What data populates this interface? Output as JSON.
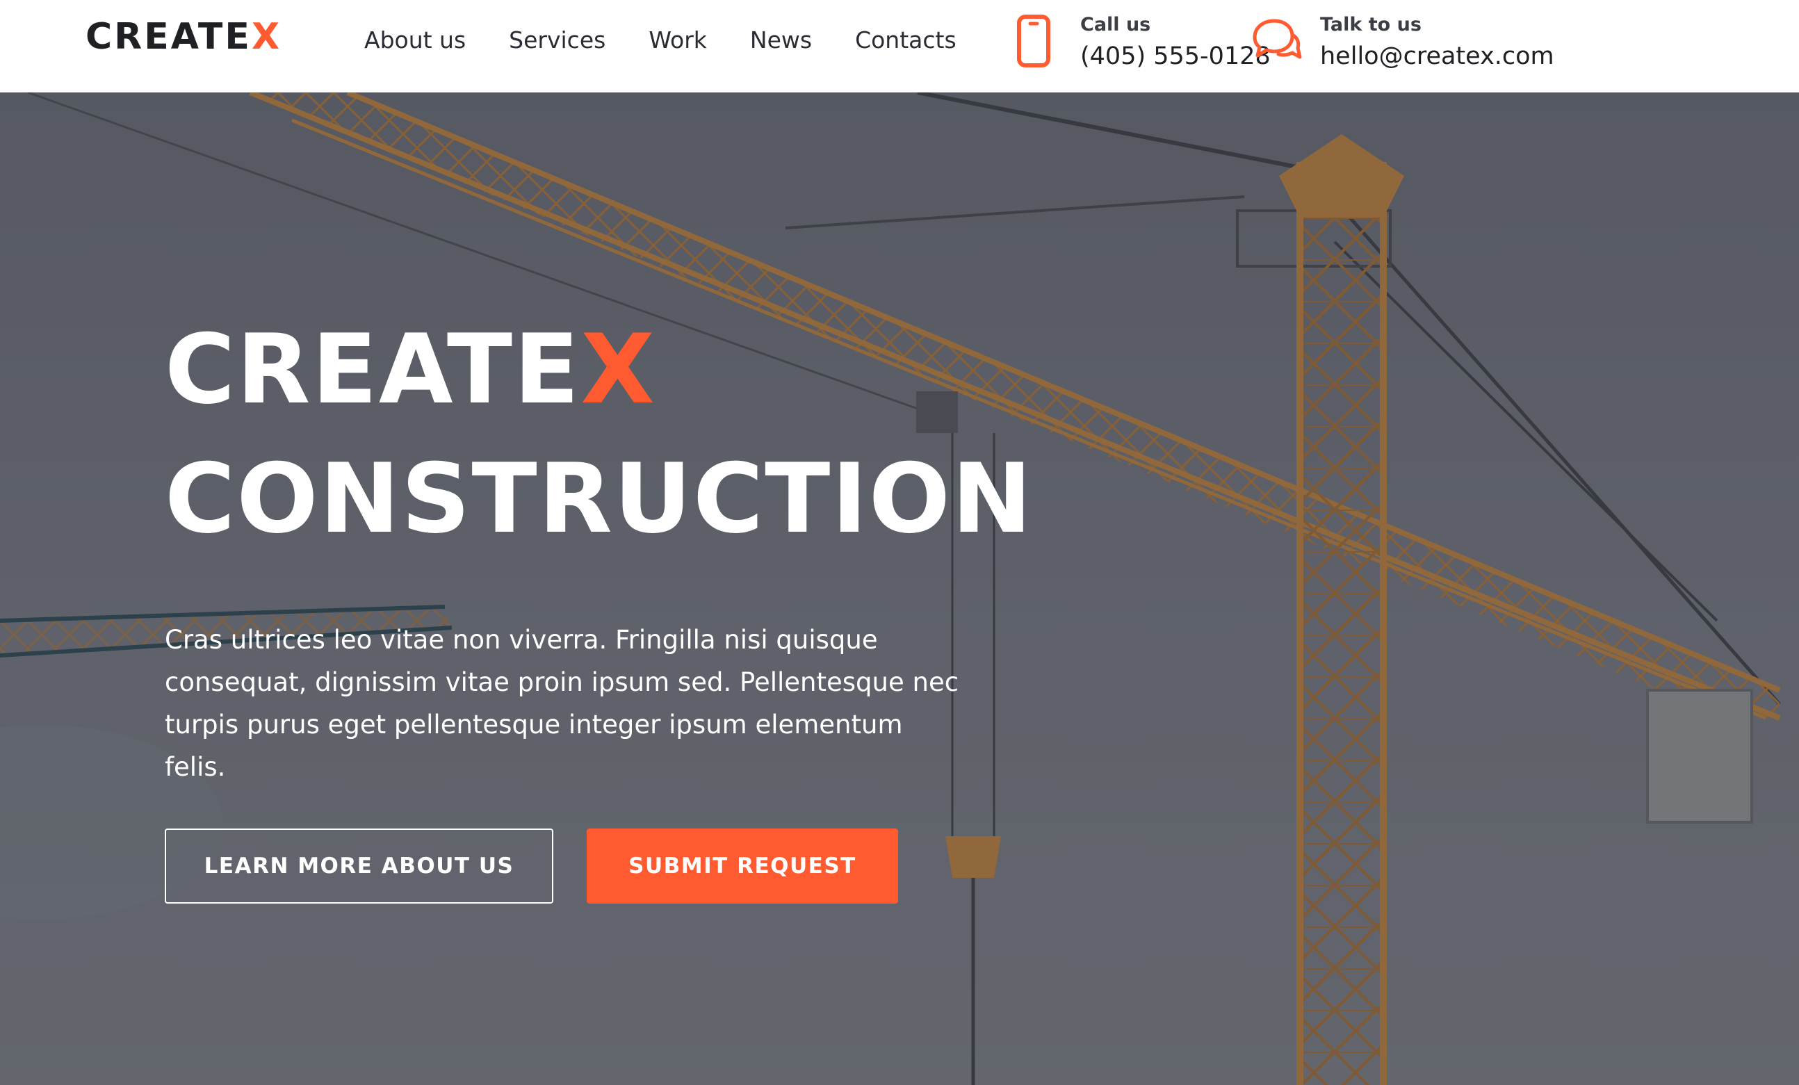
{
  "header": {
    "logo": {
      "text": "CREATE",
      "accent": "X"
    },
    "nav": [
      "About us",
      "Services",
      "Work",
      "News",
      "Contacts"
    ],
    "call": {
      "label": "Call us",
      "value": "(405) 555-0128",
      "icon": "phone-icon"
    },
    "talk": {
      "label": "Talk to us",
      "value": "hello@createx.com",
      "icon": "chat-icon"
    }
  },
  "hero": {
    "title_line1": "CREATE",
    "title_accent": "X",
    "title_line2": "CONSTRUCTION",
    "text": "Cras ultrices leo vitae non viverra. Fringilla nisi quisque consequat, dignissim vitae proin ipsum sed. Pellentesque nec turpis purus eget pellentesque integer ipsum elementum felis.",
    "btn_secondary": "LEARN MORE ABOUT US",
    "btn_primary": "SUBMIT REQUEST"
  },
  "colors": {
    "accent": "#ff5a30",
    "dark": "#1f2024",
    "overlay": "#676a72",
    "crane": "#b7772d"
  }
}
